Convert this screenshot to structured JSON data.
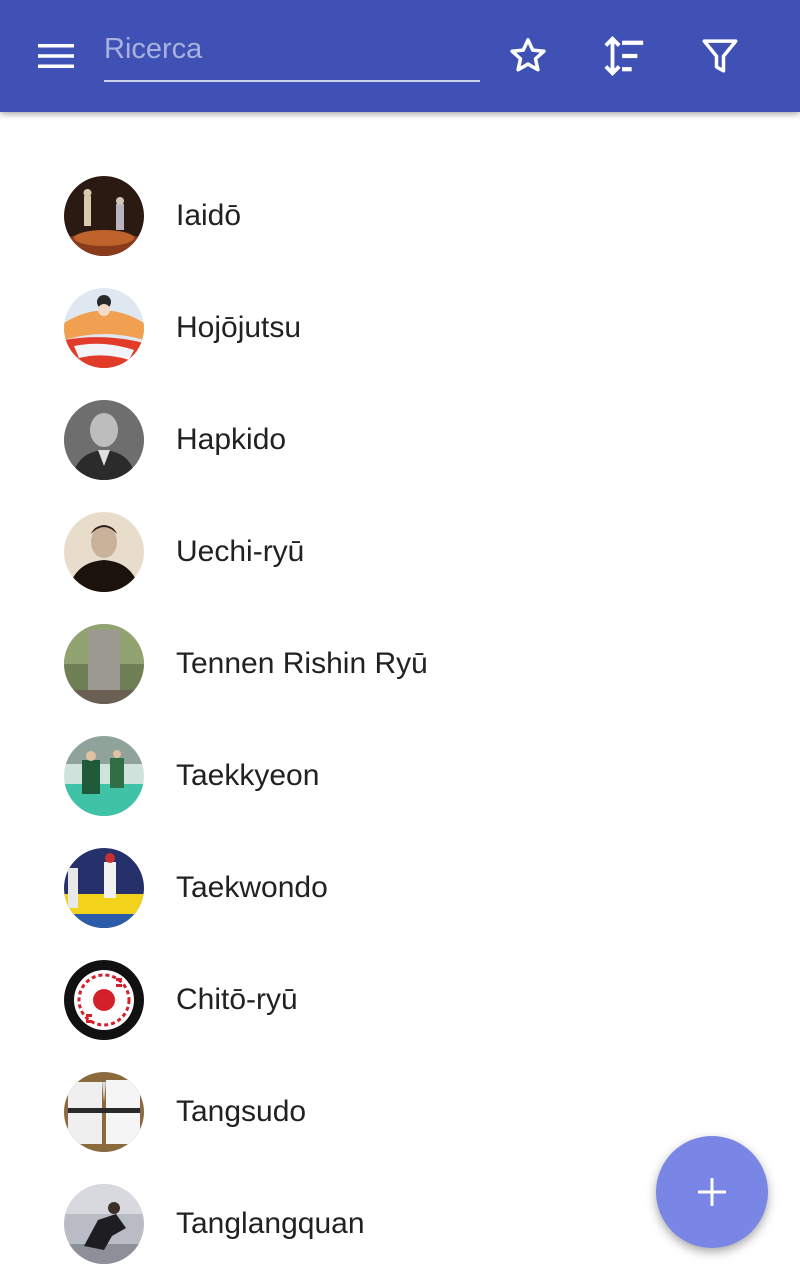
{
  "appbar": {
    "color": "#3f51b5",
    "menu_icon": "hamburger-menu-icon",
    "search": {
      "placeholder": "Ricerca",
      "value": ""
    },
    "actions": [
      {
        "name": "favorites",
        "icon": "star-outline-icon"
      },
      {
        "name": "sort",
        "icon": "sort-icon"
      },
      {
        "name": "filter",
        "icon": "filter-icon"
      }
    ]
  },
  "items": [
    {
      "label": "Iaidō"
    },
    {
      "label": "Hojōjutsu"
    },
    {
      "label": "Hapkido"
    },
    {
      "label": "Uechi-ryū"
    },
    {
      "label": "Tennen Rishin Ryū"
    },
    {
      "label": "Taekkyeon"
    },
    {
      "label": "Taekwondo"
    },
    {
      "label": "Chitō-ryū"
    },
    {
      "label": "Tangsudo"
    },
    {
      "label": "Tanglangquan"
    }
  ],
  "fab": {
    "icon": "plus-icon",
    "color": "#7986e6"
  }
}
